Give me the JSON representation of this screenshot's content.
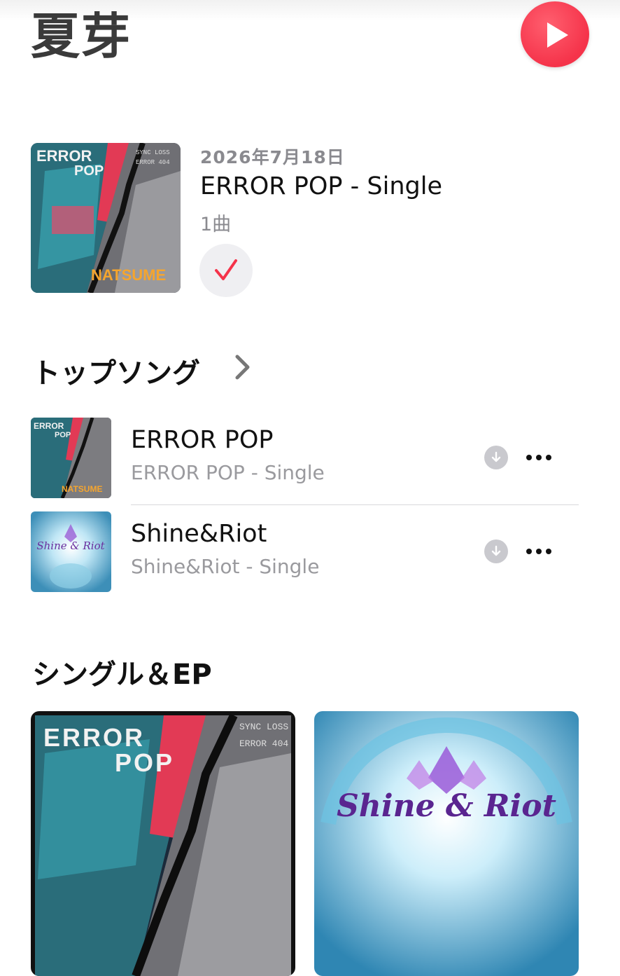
{
  "header": {
    "artist_name": "夏芽",
    "play_icon": "play-icon",
    "accent_color": "#f5334a"
  },
  "latest_release": {
    "date": "2026年7月18日",
    "title": "ERROR POP - Single",
    "track_count": "1曲",
    "added_icon": "checkmark-icon",
    "artwork": {
      "title_line1": "ERROR",
      "title_line2": "POP",
      "tag1": "SYNC LOSS",
      "tag2": "ERROR 404",
      "artist": "NATSUME"
    }
  },
  "top_songs": {
    "title": "トップソング",
    "items": [
      {
        "name": "ERROR POP",
        "subtitle": "ERROR POP - Single",
        "artwork": {
          "line1": "ERROR",
          "line2": "POP",
          "artist": "NATSUME"
        }
      },
      {
        "name": "Shine&Riot",
        "subtitle": "Shine&Riot - Single",
        "artwork": {
          "line1": "Shine & Riot"
        }
      }
    ]
  },
  "singles_ep": {
    "title": "シングル＆EP",
    "items": [
      {
        "artwork": {
          "line1": "ERROR",
          "line2": "POP",
          "tag1": "SYNC LOSS",
          "tag2": "ERROR 404"
        }
      },
      {
        "artwork": {
          "line1": "Shine & Riot"
        }
      }
    ]
  }
}
